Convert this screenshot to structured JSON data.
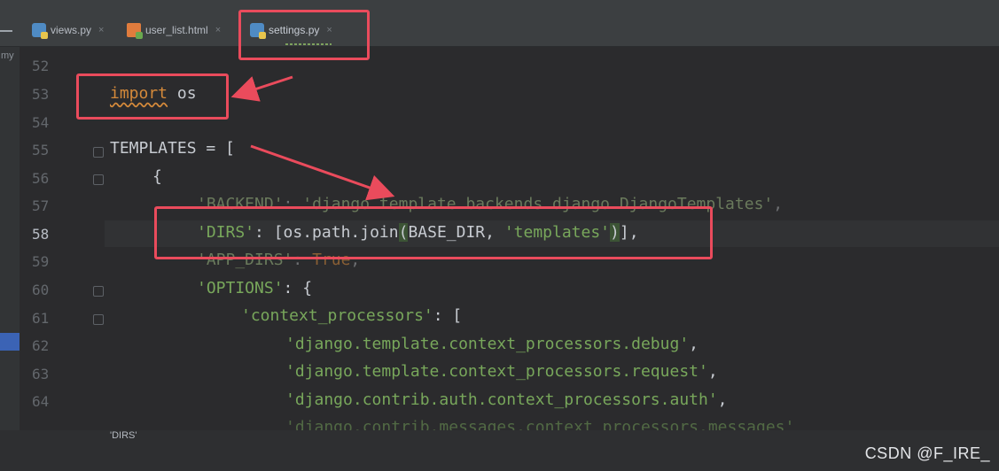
{
  "tabs": [
    {
      "label": "views.py",
      "icon": "python-file-icon",
      "active": false
    },
    {
      "label": "user_list.html",
      "icon": "html-file-icon",
      "active": false
    },
    {
      "label": "settings.py",
      "icon": "python-file-icon",
      "active": true
    }
  ],
  "tab_close_glyph": "×",
  "project_strip_label": "my",
  "line_numbers": [
    "52",
    "53",
    "54",
    "55",
    "56",
    "57",
    "58",
    "59",
    "60",
    "61",
    "62",
    "63",
    "64"
  ],
  "current_line": "58",
  "code": {
    "l53_kw": "import",
    "l53_rest": " os",
    "l55": "TEMPLATES = [",
    "l56": "{",
    "l57_key": "'BACKEND'",
    "l57_sep": ": ",
    "l57_val": "'django.template.backends.django.DjangoTemplates'",
    "l57_end": ",",
    "l58_key": "'DIRS'",
    "l58_a": ": [os.path.join",
    "l58_paren": "(",
    "l58_b": "BASE_DIR, ",
    "l58_str": "'templates'",
    "l58_close": ")",
    "l58_end": "],",
    "l59_key": "'APP_DIRS'",
    "l59_sep": ": ",
    "l59_val": "True",
    "l59_end": ",",
    "l60_key": "'OPTIONS'",
    "l60_end": ": {",
    "l61_key": "'context_processors'",
    "l61_end": ": [",
    "l62_str": "'django.template.context_processors.debug'",
    "l62_end": ",",
    "l63_str": "'django.template.context_processors.request'",
    "l63_end": ",",
    "l64_str": "'django.contrib.auth.context_processors.auth'",
    "l64_end": ",",
    "l65_partial": "'django.contrib.messages.context_processors.messages'"
  },
  "breadcrumb": "'DIRS'",
  "watermark": "CSDN @F_IRE_",
  "colors": {
    "annotation": "#ea4b5c",
    "keyword": "#d4893a",
    "string": "#78a75b",
    "background": "#2b2b2d"
  }
}
